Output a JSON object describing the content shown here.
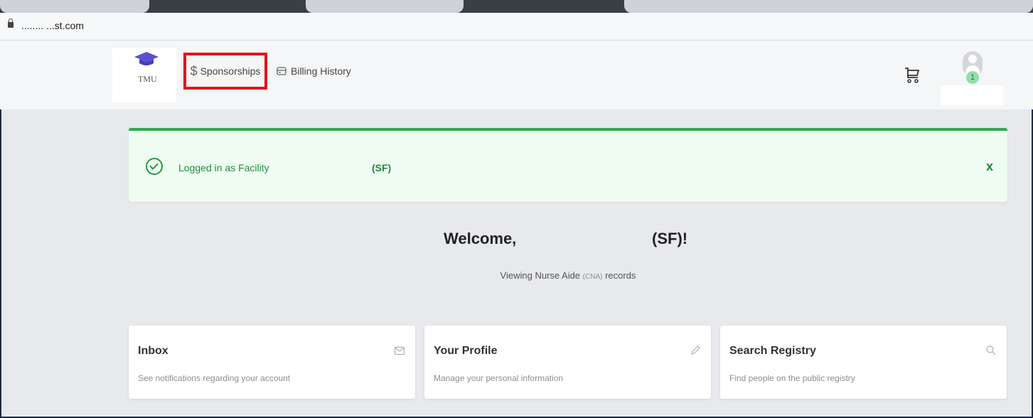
{
  "browser": {
    "url": "........ ...st.com"
  },
  "nav": {
    "logo_text": "TMU",
    "sponsorships_label": "Sponsorships",
    "billing_label": "Billing History",
    "notification_count": "1"
  },
  "alert": {
    "message": "Logged in as Facility",
    "code": "(SF)",
    "close": "x"
  },
  "welcome": {
    "greeting": "Welcome,",
    "suffix": "(SF)!",
    "viewing_prefix": "Viewing Nurse Aide",
    "viewing_tag": "(CNA)",
    "viewing_suffix": "records"
  },
  "cards": [
    {
      "title": "Inbox",
      "description": "See notifications regarding your account",
      "icon": "mail-icon"
    },
    {
      "title": "Your Profile",
      "description": "Manage your personal information",
      "icon": "pencil-icon"
    },
    {
      "title": "Search Registry",
      "description": "Find people on the public registry",
      "icon": "search-icon"
    }
  ],
  "colors": {
    "alert_green": "#2eaa50",
    "alert_text": "#238b43",
    "highlight_red": "#e2141b",
    "logo_purple": "#5b4fd1"
  }
}
